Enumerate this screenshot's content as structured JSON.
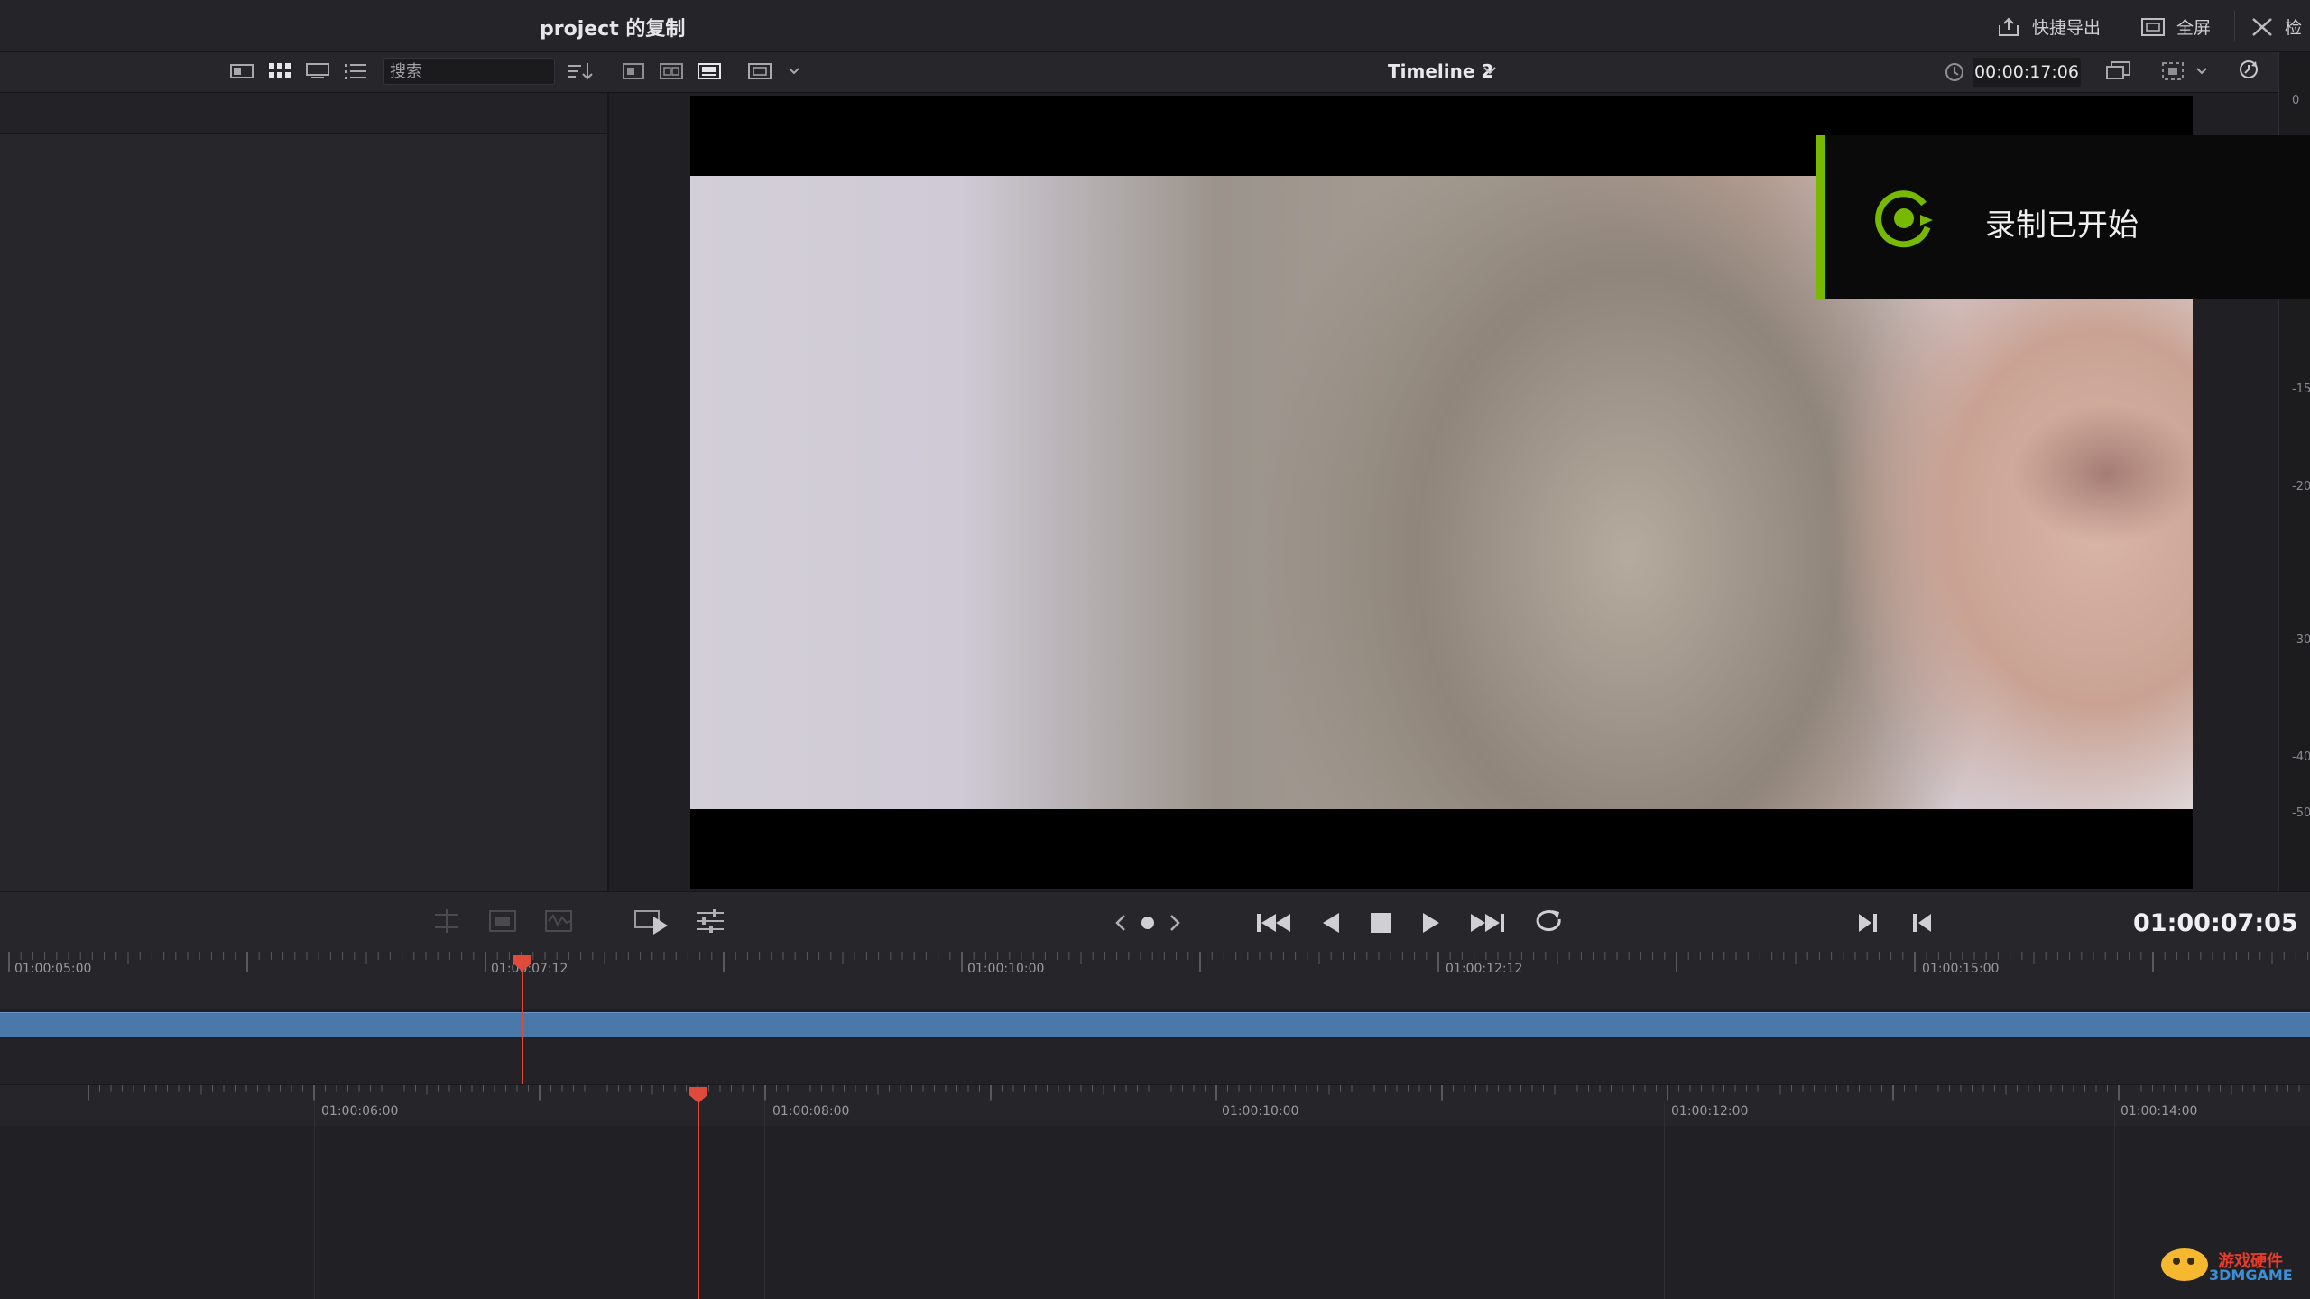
{
  "titlebar": {
    "project_title": "project 的复制",
    "quick_export": "快捷导出",
    "fullscreen": "全屏",
    "inspector": "检"
  },
  "toolbar": {
    "search_placeholder": "搜索",
    "timeline_name": "Timeline 2",
    "source_timecode": "00:00:17:06"
  },
  "notification": {
    "text": "录制已开始",
    "accent": "#76b900"
  },
  "meter": {
    "labels": [
      "0",
      "-15",
      "-20",
      "-30",
      "-40",
      "-50"
    ]
  },
  "transport": {
    "current_timecode": "01:00:07:05"
  },
  "timeline_upper": {
    "ruler_labels": [
      "01:00:05:00",
      "01:00:07:12",
      "01:00:10:00",
      "01:00:12:12",
      "01:00:15:00"
    ]
  },
  "timeline_lower": {
    "ruler_labels": [
      "01:00:06:00",
      "01:00:08:00",
      "01:00:10:00",
      "01:00:12:00",
      "01:00:14:00"
    ]
  },
  "colors": {
    "clip": "#4a78a8",
    "playhead": "#e04a3a"
  },
  "watermark": {
    "line1": "游戏硬件",
    "line2": "3DMGAME"
  }
}
